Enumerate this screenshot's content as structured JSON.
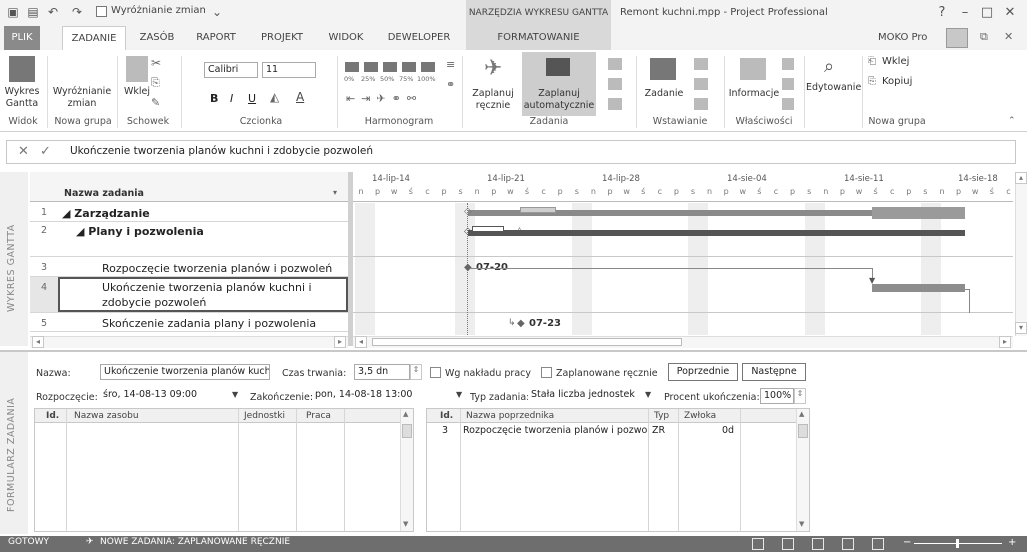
{
  "titlebar": {
    "highlight_label": "Wyróżnianie zmian",
    "context_title": "NARZĘDZIA WYKRESU GANTTA",
    "window_title": "Remont kuchni.mpp - Project Professional",
    "help": "?",
    "minimize": "–",
    "restore": "□",
    "close": "✕"
  },
  "tabs": [
    "PLIK",
    "ZADANIE",
    "ZASÓB",
    "RAPORT",
    "PROJEKT",
    "WIDOK",
    "DEWELOPER",
    "FORMATOWANIE"
  ],
  "account": "MOKO Pro",
  "ribbon": {
    "gantt_btn": "Wykres Gantta",
    "highlight_btn": "Wyróżnianie zmian",
    "paste_btn": "Wklej",
    "font_name": "Calibri",
    "font_size": "11",
    "bold": "B",
    "italic": "I",
    "underline": "U",
    "pct_labels": [
      "0%",
      "25%",
      "50%",
      "75%",
      "100%"
    ],
    "manual_btn": "Zaplanuj ręcznie",
    "auto_btn": "Zaplanuj automatycznie",
    "task_btn": "Zadanie",
    "info_btn": "Informacje",
    "edit_btn": "Edytowanie",
    "paste2": "Wklej",
    "copy": "Kopiuj",
    "groups": [
      "Widok",
      "Nowa grupa",
      "Schowek",
      "Czcionka",
      "Harmonogram",
      "Zadania",
      "Wstawianie",
      "Właściwości",
      "Nowa grupa"
    ]
  },
  "entry_bar": {
    "cancel": "✕",
    "accept": "✓",
    "text": "Ukończenie tworzenia planów kuchni i zdobycie pozwoleń"
  },
  "gantt_side_label": "WYKRES GANTTA",
  "table": {
    "header": "Nazwa zadania",
    "rows": [
      {
        "id": "1",
        "name": "◢ Zarządzanie"
      },
      {
        "id": "2",
        "name": "◢ Plany i pozwolenia"
      },
      {
        "id": "3",
        "name": "Rozpoczęcie tworzenia planów i pozwoleń"
      },
      {
        "id": "4",
        "name": "Ukończenie tworzenia planów kuchni i",
        "name2": "zdobycie pozwoleń"
      },
      {
        "id": "5",
        "name": "Skończenie zadania plany i pozwolenia"
      }
    ]
  },
  "timescale": {
    "weeks": [
      "14-lip-14",
      "14-lip-21",
      "14-lip-28",
      "14-sie-04",
      "14-sie-11",
      "14-sie-18"
    ],
    "days": [
      "n",
      "p",
      "w",
      "ś",
      "c",
      "p",
      "s",
      "n",
      "p",
      "w",
      "ś",
      "c",
      "p",
      "s",
      "n",
      "p",
      "w",
      "ś",
      "c",
      "p",
      "s",
      "n",
      "p",
      "w",
      "ś",
      "c",
      "p",
      "s",
      "n",
      "p",
      "w",
      "ś",
      "c",
      "p",
      "s",
      "n",
      "p",
      "w",
      "ś",
      "c"
    ],
    "milestone_3": "07-20",
    "milestone_5": "07-23"
  },
  "form_side_label": "FORMULARZ ZADANIA",
  "form": {
    "name_label": "Nazwa:",
    "name_value": "Ukończenie tworzenia planów kuch",
    "duration_label": "Czas trwania:",
    "duration_value": "3,5 dn",
    "effort_label": "Wg nakładu pracy",
    "manual_label": "Zaplanowane ręcznie",
    "prev_btn": "Poprzednie",
    "next_btn": "Następne",
    "start_label": "Rozpoczęcie:",
    "start_value": "śro, 14-08-13 09:00",
    "finish_label": "Zakończenie:",
    "finish_value": "pon, 14-08-18 13:00",
    "type_label": "Typ zadania:",
    "type_value": "Stała liczba jednostek",
    "pct_label": "Procent ukończenia:",
    "pct_value": "100%",
    "res_headers": [
      "Id.",
      "Nazwa zasobu",
      "Jednostki",
      "Praca"
    ],
    "pred_headers": [
      "Id.",
      "Nazwa poprzednika",
      "Typ",
      "Zwłoka"
    ],
    "pred_row": {
      "id": "3",
      "name": "Rozpoczęcie tworzenia planów i pozwol",
      "type": "ZR",
      "lag": "0d"
    }
  },
  "status": {
    "ready": "GOTOWY",
    "new_tasks": "NOWE ZADANIA: ZAPLANOWANE RĘCZNIE"
  }
}
